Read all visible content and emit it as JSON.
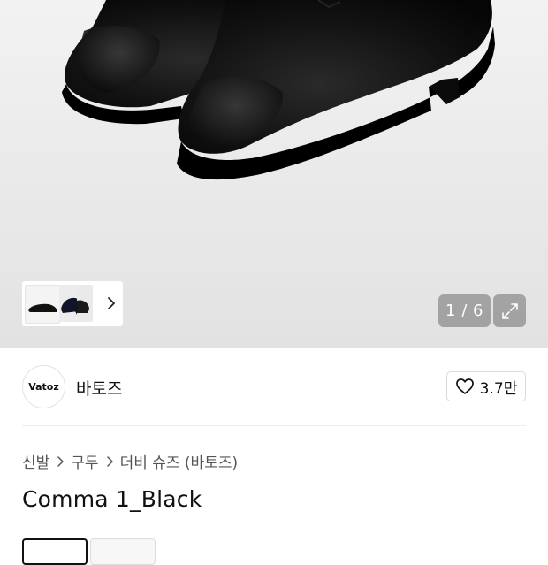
{
  "gallery": {
    "counter": "1 / 6",
    "expand_icon": "expand-icon",
    "thumb_next_icon": "chevron-right-icon"
  },
  "brand": {
    "logo_text": "Vatoz",
    "name": "바토즈",
    "like_icon": "heart-outline-icon",
    "like_count": "3.7만"
  },
  "breadcrumb": {
    "items": [
      "신발",
      "구두",
      "더비 슈즈 (바토즈)"
    ],
    "separator_icon": "chevron-right-icon"
  },
  "product": {
    "title": "Comma 1_Black"
  },
  "options": {
    "selected_index": 0
  },
  "colors": {
    "accent": "#111111",
    "overlay": "#6e6e6e"
  }
}
